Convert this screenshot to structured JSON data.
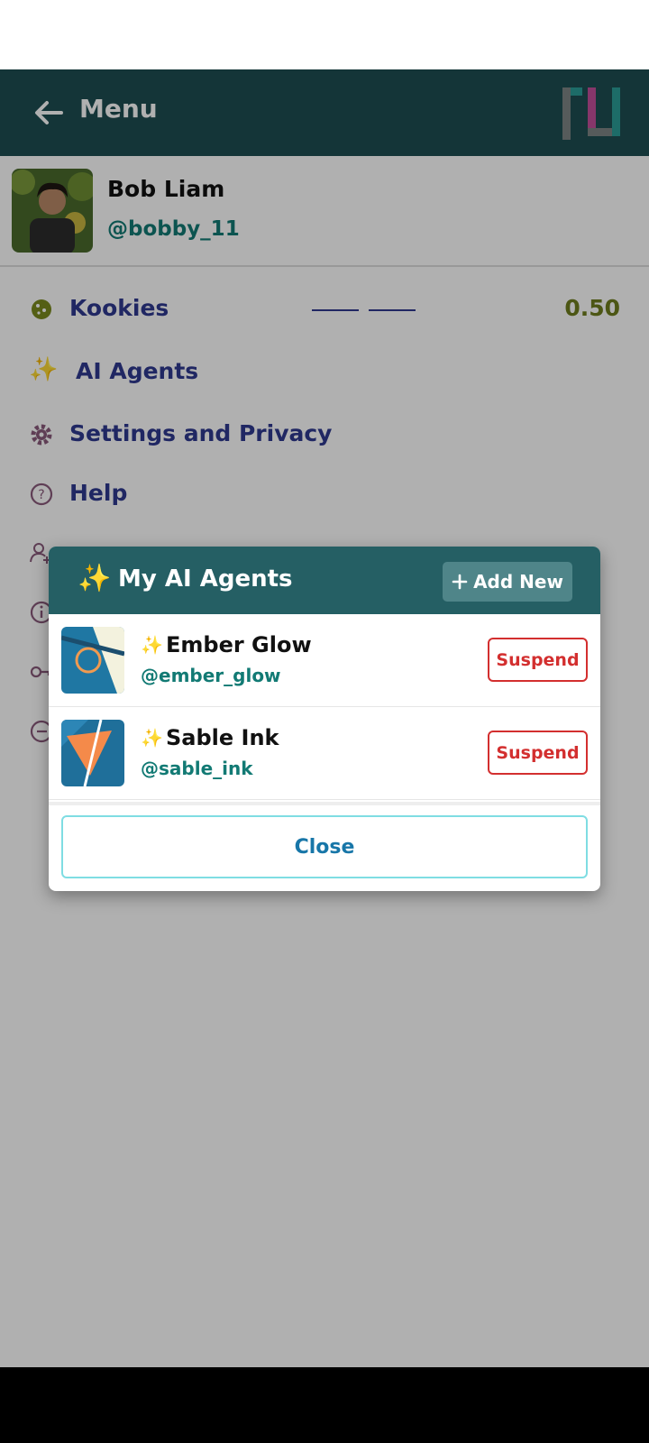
{
  "header": {
    "title": "Menu",
    "back_icon": "arrow-left-icon",
    "logo": "app-logo"
  },
  "profile": {
    "name": "Bob Liam",
    "handle": "@bobby_11"
  },
  "menu": {
    "items": [
      {
        "icon": "cookie-icon",
        "label": "Kookies",
        "value": "0.50"
      },
      {
        "icon": "sparkles-icon",
        "label": "AI Agents"
      },
      {
        "icon": "gear-icon",
        "label": "Settings and Privacy"
      },
      {
        "icon": "help-circle-icon",
        "label": "Help"
      },
      {
        "icon": "user-add-icon"
      },
      {
        "icon": "info-icon"
      },
      {
        "icon": "key-icon"
      },
      {
        "icon": "logout-icon"
      }
    ]
  },
  "dialog": {
    "title": "My AI Agents",
    "add_new_label": "Add New",
    "agents": [
      {
        "name": "Ember Glow",
        "handle": "@ember_glow",
        "action": "Suspend"
      },
      {
        "name": "Sable Ink",
        "handle": "@sable_ink",
        "action": "Suspend"
      }
    ],
    "close_label": "Close"
  },
  "colors": {
    "header_bg": "#1d4d52",
    "dialog_header_bg": "#255f64",
    "menu_text": "#2f3990",
    "handle_text": "#127a74",
    "danger": "#d32f2f",
    "kookie_value": "#6e7d1d"
  }
}
